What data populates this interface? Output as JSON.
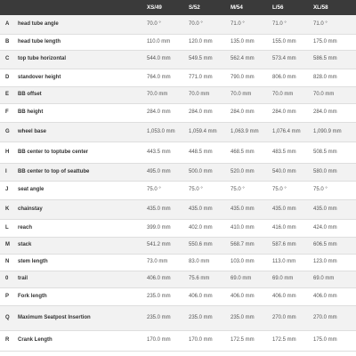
{
  "table": {
    "sizes": [
      "XS/49",
      "S/52",
      "M/54",
      "L/56",
      "XL/58"
    ],
    "rows": [
      {
        "letter": "A",
        "label": "head tube angle",
        "values": [
          "70.0 °",
          "70.0 °",
          "71.0 °",
          "71.0 °",
          "71.0 °"
        ]
      },
      {
        "letter": "B",
        "label": "head tube length",
        "values": [
          "110.0 mm",
          "120.0 mm",
          "135.0 mm",
          "155.0 mm",
          "175.0 mm"
        ]
      },
      {
        "letter": "C",
        "label": "top tube horizontal",
        "values": [
          "544.0 mm",
          "549.5 mm",
          "562.4 mm",
          "573.4 mm",
          "586.5 mm"
        ]
      },
      {
        "letter": "D",
        "label": "standover height",
        "values": [
          "764.0 mm",
          "771.0 mm",
          "790.0 mm",
          "806.0 mm",
          "828.0 mm"
        ]
      },
      {
        "letter": "E",
        "label": "BB offset",
        "values": [
          "70.0 mm",
          "70.0 mm",
          "70.0 mm",
          "70.0 mm",
          "70.0 mm"
        ]
      },
      {
        "letter": "F",
        "label": "BB height",
        "values": [
          "284.0 mm",
          "284.0 mm",
          "284.0 mm",
          "284.0 mm",
          "284.0 mm"
        ]
      },
      {
        "letter": "G",
        "label": "wheel base",
        "values": [
          "1,053.0 mm",
          "1,059.4 mm",
          "1,063.9 mm",
          "1,076.4 mm",
          "1,090.9 mm"
        ]
      },
      {
        "letter": "H",
        "label": "BB center to toptube center",
        "values": [
          "443.5 mm",
          "448.5 mm",
          "468.5 mm",
          "483.5 mm",
          "508.5 mm"
        ]
      },
      {
        "letter": "I",
        "label": "BB center to top of seattube",
        "values": [
          "495.0 mm",
          "500.0 mm",
          "520.0 mm",
          "540.0 mm",
          "580.0 mm"
        ]
      },
      {
        "letter": "J",
        "label": "seat angle",
        "values": [
          "75.0 °",
          "75.0 °",
          "75.0 °",
          "75.0 °",
          "75.0 °"
        ]
      },
      {
        "letter": "K",
        "label": "chainstay",
        "values": [
          "435.0 mm",
          "435.0 mm",
          "435.0 mm",
          "435.0 mm",
          "435.0 mm"
        ]
      },
      {
        "letter": "L",
        "label": "reach",
        "values": [
          "399.0 mm",
          "402.0 mm",
          "410.0 mm",
          "416.0 mm",
          "424.0 mm"
        ]
      },
      {
        "letter": "M",
        "label": "stack",
        "values": [
          "541.2 mm",
          "550.6 mm",
          "568.7 mm",
          "587.6 mm",
          "606.5 mm"
        ]
      },
      {
        "letter": "N",
        "label": "stem length",
        "values": [
          "73.0 mm",
          "83.0 mm",
          "103.0 mm",
          "113.0 mm",
          "123.0 mm"
        ]
      },
      {
        "letter": "0",
        "label": "trail",
        "values": [
          "406.0 mm",
          "75.6 mm",
          "69.0 mm",
          "69.0 mm",
          "69.0 mm"
        ]
      },
      {
        "letter": "P",
        "label": "Fork length",
        "values": [
          "235.0 mm",
          "406.0 mm",
          "406.0 mm",
          "406.0 mm",
          "406.0 mm"
        ]
      },
      {
        "letter": "Q",
        "label": "Maximum Seatpost Insertion",
        "values": [
          "235.0 mm",
          "235.0 mm",
          "235.0 mm",
          "270.0 mm",
          "270.0 mm"
        ]
      },
      {
        "letter": "R",
        "label": "Crank Length",
        "values": [
          "170.0 mm",
          "170.0 mm",
          "172.5 mm",
          "172.5 mm",
          "175.0 mm"
        ]
      }
    ]
  }
}
